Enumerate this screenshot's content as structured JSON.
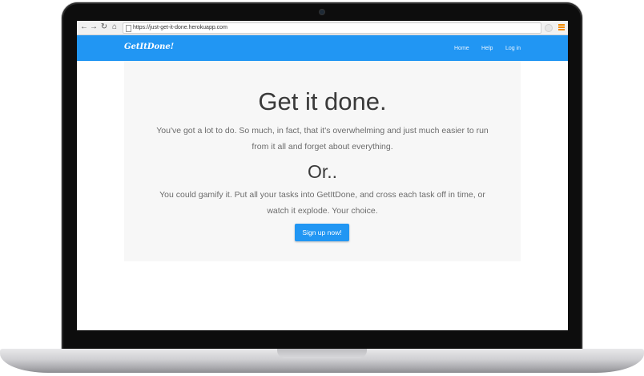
{
  "browser": {
    "url": "https://just-get-it-done.herokuapp.com",
    "icons": {
      "back": "back-arrow-icon",
      "forward": "forward-arrow-icon",
      "reload": "reload-icon",
      "home": "home-icon",
      "page": "page-icon",
      "extension": "extension-icon",
      "menu": "menu-icon"
    }
  },
  "navbar": {
    "brand": "GetItDone!",
    "links": [
      "Home",
      "Help",
      "Log in"
    ],
    "color": "#2196f3"
  },
  "hero": {
    "title": "Get it done.",
    "text_line1": "You've got a lot to do. So much, in fact, that it's overwhelming and just much easier to run",
    "text_line2": "from it all and forget about everything.",
    "subtitle": "Or..",
    "text2_line1": "You could gamify it. Put all your tasks into GetItDone, and cross each task off in time, or",
    "text2_line2": "watch it explode. Your choice.",
    "cta_label": "Sign up now!"
  }
}
